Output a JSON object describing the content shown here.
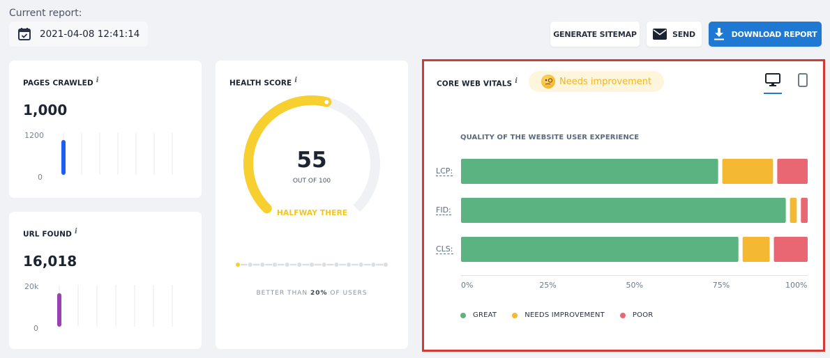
{
  "header": {
    "current_report_label": "Current report:",
    "report_date": "2021-04-08 12:41:14",
    "buttons": {
      "generate_sitemap": "GENERATE SITEMAP",
      "send": "SEND",
      "download_report": "DOWNLOAD REPORT"
    }
  },
  "pages_crawled": {
    "title": "PAGES CRAWLED",
    "info": "i",
    "value": "1,000",
    "axis_max_label": "1200",
    "axis_min_label": "0",
    "axis_max": 1200,
    "bars": [
      1000
    ],
    "slots": 7,
    "bar_color": "#1f5ef5"
  },
  "url_found": {
    "title": "URL FOUND",
    "info": "i",
    "value": "16,018",
    "axis_max_label": "20k",
    "axis_min_label": "0",
    "axis_max": 20000,
    "bars": [
      16018
    ],
    "slots": 7,
    "bar_color": "#9b3fb5"
  },
  "health_score": {
    "title": "HEALTH SCORE",
    "info": "i",
    "score": "55",
    "score_value": 55,
    "max_label": "OUT OF 100",
    "status": "HALFWAY THERE",
    "gauge_color": "#f7cf2e",
    "track_color": "#f0f1f5",
    "progress_steps": 12,
    "progress_active": 1,
    "better_than_prefix": "BETTER THAN ",
    "better_than_value": "20%",
    "better_than_suffix": " OF USERS"
  },
  "core_web_vitals": {
    "title": "CORE WEB VITALS",
    "info": "i",
    "status_badge": "Needs improvement",
    "device_tabs": [
      {
        "name": "desktop",
        "active": true
      },
      {
        "name": "mobile",
        "active": false
      }
    ]
  },
  "chart_data": {
    "type": "bar",
    "orientation": "horizontal-stacked",
    "title": "QUALITY OF THE WEBSITE USER EXPERIENCE",
    "categories": [
      "LCP:",
      "FID:",
      "CLS:"
    ],
    "series": [
      {
        "name": "GREAT",
        "color": "#5bb381",
        "values": [
          76,
          96,
          82
        ]
      },
      {
        "name": "NEEDS IMPROVEMENT",
        "color": "#f4b833",
        "values": [
          15,
          2,
          8
        ]
      },
      {
        "name": "POOR",
        "color": "#e96673",
        "values": [
          9,
          2,
          10
        ]
      }
    ],
    "xlim": [
      0,
      100
    ],
    "x_ticks": [
      "0%",
      "25%",
      "50%",
      "75%",
      "100%"
    ],
    "legend": [
      "GREAT",
      "NEEDS IMPROVEMENT",
      "POOR"
    ],
    "legend_position": "bottom-left",
    "grid": false
  }
}
